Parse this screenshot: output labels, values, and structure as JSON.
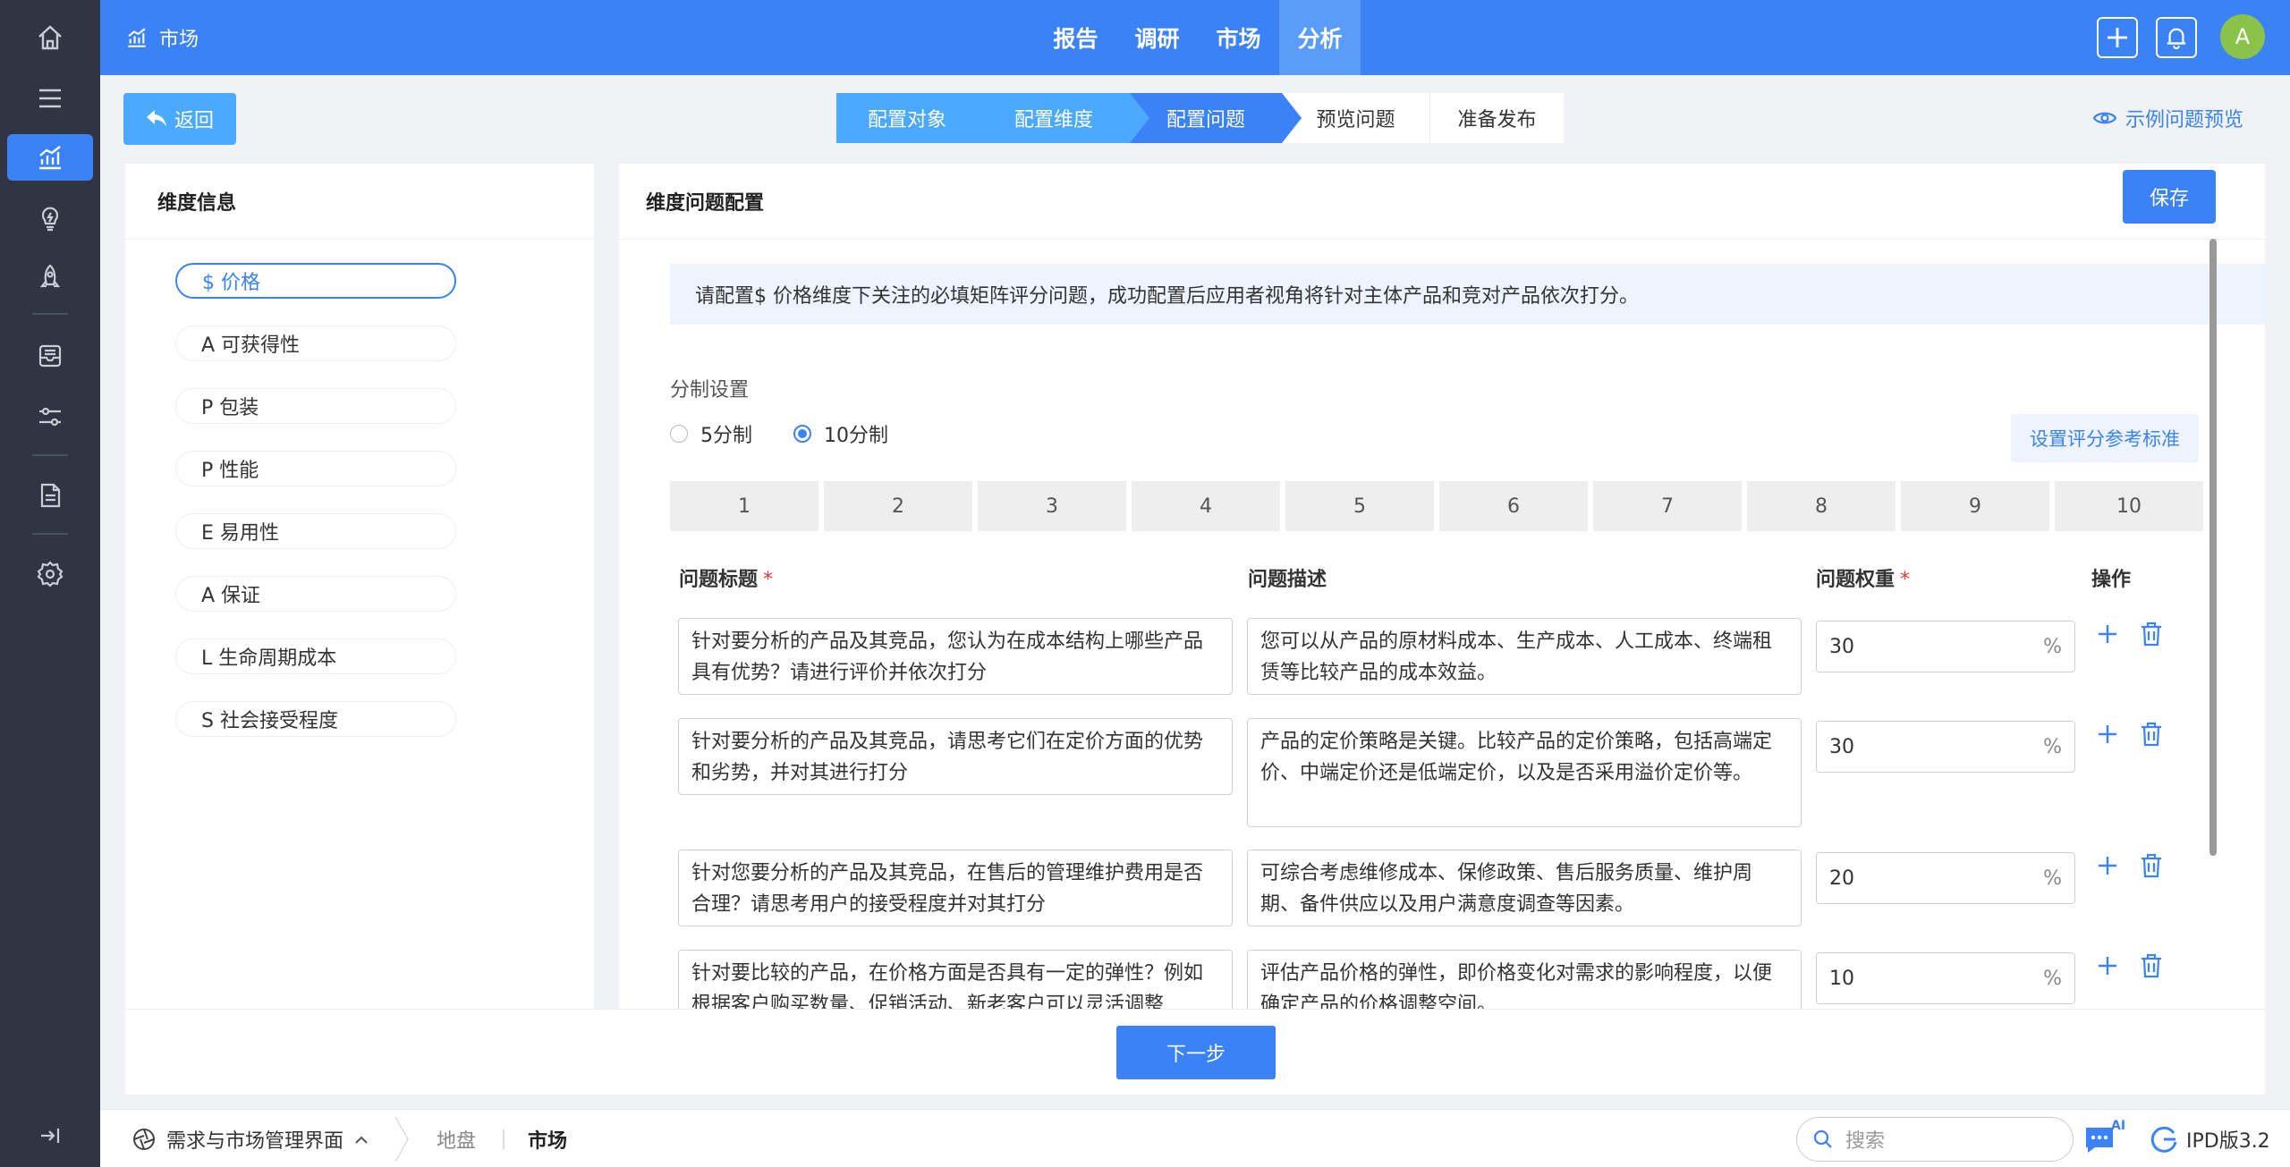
{
  "topbar": {
    "brand": "市场",
    "nav": [
      "报告",
      "调研",
      "市场",
      "分析"
    ],
    "active_nav": "分析",
    "avatar": "A"
  },
  "toolbar": {
    "back_label": "返回",
    "steps": [
      "配置对象",
      "配置维度",
      "配置问题",
      "预览问题",
      "准备发布"
    ],
    "current_step": "配置问题",
    "preview_label": "示例问题预览"
  },
  "dimensions": {
    "title": "维度信息",
    "items": [
      "$ 价格",
      "A 可获得性",
      "P 包装",
      "P 性能",
      "E 易用性",
      "A 保证",
      "L 生命周期成本",
      "S 社会接受程度"
    ],
    "active": "$ 价格"
  },
  "config": {
    "title": "维度问题配置",
    "save_label": "保存",
    "notice": "请配置$ 价格维度下关注的必填矩阵评分问题，成功配置后应用者视角将针对主体产品和竞对产品依次打分。",
    "scale_section": "分制设置",
    "scale_options": [
      "5分制",
      "10分制"
    ],
    "scale_selected": "10分制",
    "ref_button": "设置评分参考标准",
    "scale_values": [
      "1",
      "2",
      "3",
      "4",
      "5",
      "6",
      "7",
      "8",
      "9",
      "10"
    ],
    "columns": {
      "title": "问题标题",
      "desc": "问题描述",
      "weight": "问题权重",
      "ops": "操作"
    },
    "required_mark": "*",
    "percent": "%",
    "questions": [
      {
        "title": "针对要分析的产品及其竞品，您认为在成本结构上哪些产品具有优势？请进行评价并依次打分",
        "desc": "您可以从产品的原材料成本、生产成本、人工成本、终端租赁等比较产品的成本效益。",
        "weight": "30"
      },
      {
        "title": "针对要分析的产品及其竞品，请思考它们在定价方面的优势和劣势，并对其进行打分",
        "desc": "产品的定价策略是关键。比较产品的定价策略，包括高端定价、中端定价还是低端定价，以及是否采用溢价定价等。",
        "weight": "30"
      },
      {
        "title": "针对您要分析的产品及其竞品，在售后的管理维护费用是否合理？请思考用户的接受程度并对其打分",
        "desc": "可综合考虑维修成本、保修政策、售后服务质量、维护周期、备件供应以及用户满意度调查等因素。",
        "weight": "20"
      },
      {
        "title": "针对要比较的产品，在价格方面是否具有一定的弹性？例如根据客户购买数量、促销活动、新老客户可以灵活调整",
        "desc": "评估产品价格的弹性，即价格变化对需求的影响程度，以便确定产品的价格调整空间。",
        "weight": "10"
      }
    ]
  },
  "footer": {
    "next_label": "下一步"
  },
  "statusbar": {
    "app": "需求与市场管理界面",
    "crumbs": [
      "地盘",
      "市场"
    ],
    "search_placeholder": "搜索",
    "ai_label": "AI",
    "version": "IPD版3.2"
  }
}
